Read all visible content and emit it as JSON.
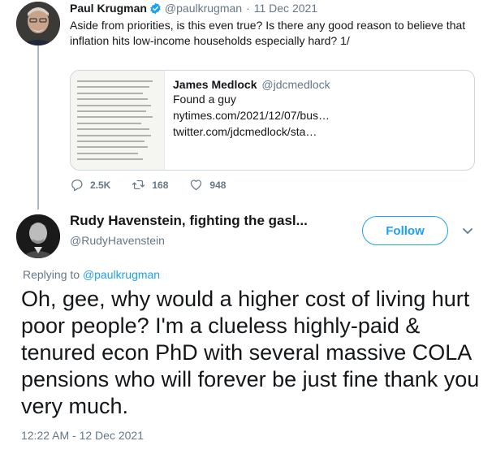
{
  "parent_tweet": {
    "author_name": "Paul Krugman",
    "handle": "@paulkrugman",
    "separator": "·",
    "date": "11 Dec 2021",
    "text": "Aside from priorities, is this even true? Is there any good reason to believe that inflation hits low-income households especially hard? 1/",
    "verified_icon": "verified-badge-icon",
    "quoted_tweet": {
      "author_name": "James Medlock",
      "handle": "@jdcmedlock",
      "lines": [
        "Found a guy",
        "nytimes.com/2021/12/07/bus…",
        "twitter.com/jdcmedlock/sta…"
      ],
      "image_icon": "newspaper-clipping-image"
    },
    "actions": {
      "reply_count": "2.5K",
      "retweet_count": "168",
      "like_count": "948"
    }
  },
  "main_tweet": {
    "author_name": "Rudy Havenstein, fighting the gasl...",
    "handle": "@RudyHavenstein",
    "follow_label": "Follow",
    "replying_prefix": "Replying to ",
    "replying_to": "@paulkrugman",
    "text": "Oh, gee, why would a higher cost of living hurt poor people? I'm a clueless highly-paid & tenured econ PhD with several massive COLA pensions who will forever be just fine thank you very much.",
    "timestamp": "12:22 AM - 12 Dec 2021"
  },
  "colors": {
    "accent": "#1da1f2",
    "muted": "#657786",
    "text": "#14171a",
    "border": "#ccd6dd",
    "thread_line": "#aab8c2"
  }
}
